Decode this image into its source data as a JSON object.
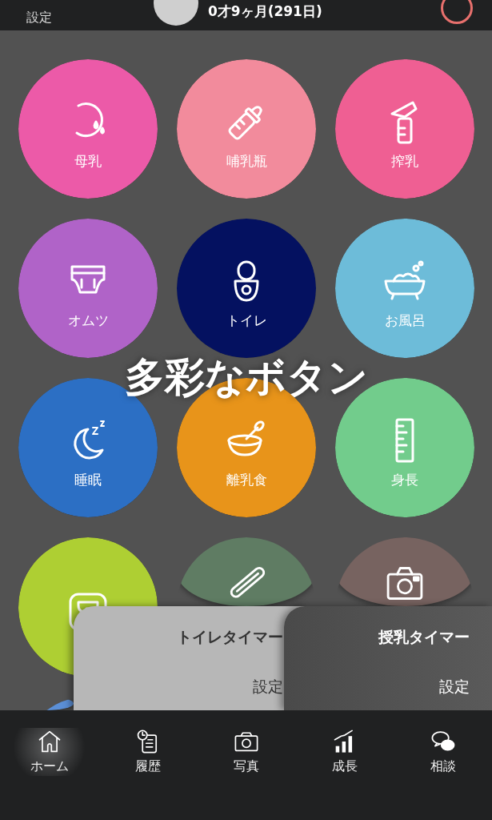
{
  "header": {
    "settings": "設定",
    "age": "0才9ヶ月(291日)"
  },
  "caption": "多彩なボタン",
  "buttons": [
    {
      "label": "母乳",
      "color": "#ec5aa8"
    },
    {
      "label": "哺乳瓶",
      "color": "#f28b9c"
    },
    {
      "label": "搾乳",
      "color": "#ef5f93"
    },
    {
      "label": "オムツ",
      "color": "#b063c8"
    },
    {
      "label": "トイレ",
      "color": "#041160"
    },
    {
      "label": "お風呂",
      "color": "#6dbcd9"
    },
    {
      "label": "睡眠",
      "color": "#2c6fc4"
    },
    {
      "label": "離乳食",
      "color": "#e8941a"
    },
    {
      "label": "身長",
      "color": "#72cc8c"
    },
    {
      "color": "#aecf33"
    },
    {
      "color": "#5f7c63"
    },
    {
      "color": "#776360"
    },
    {
      "color": "#5b8fd6"
    }
  ],
  "timers": [
    {
      "title": "トイレタイマー",
      "settings": "設定",
      "kind": "light"
    },
    {
      "title": "授乳タイマー",
      "settings": "設定",
      "kind": "dark"
    }
  ],
  "tabs": [
    {
      "label": "ホーム",
      "selected": true
    },
    {
      "label": "履歴",
      "selected": false
    },
    {
      "label": "写真",
      "selected": false
    },
    {
      "label": "成長",
      "selected": false
    },
    {
      "label": "相談",
      "selected": false
    }
  ]
}
